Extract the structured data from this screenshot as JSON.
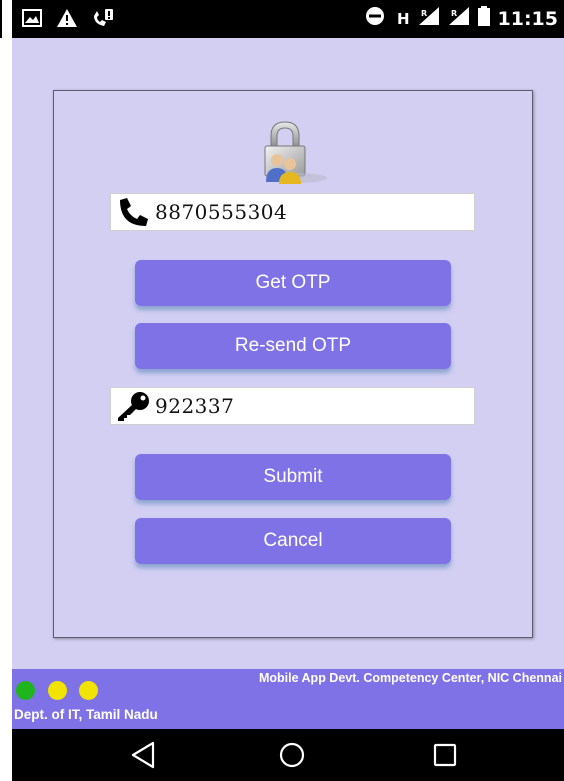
{
  "status_bar": {
    "left_icons": [
      "image-icon",
      "warning-icon",
      "phone-alert-icon"
    ],
    "right_icons": [
      "do-not-disturb-icon",
      "h-network-icon",
      "signal-r-icon",
      "signal-r-icon-2",
      "battery-icon"
    ],
    "h_label": "H",
    "time": "11:15"
  },
  "login": {
    "lock_icon": "lock-users-icon",
    "phone": {
      "icon": "phone-icon",
      "value": "8870555304"
    },
    "get_otp_label": "Get OTP",
    "resend_otp_label": "Re-send OTP",
    "otp": {
      "icon": "key-icon",
      "value": "922337"
    },
    "submit_label": "Submit",
    "cancel_label": "Cancel"
  },
  "footer": {
    "dots": [
      "#1fb51f",
      "#f2e300",
      "#f2e300"
    ],
    "credit": "Mobile App Devt. Competency Center, NIC Chennai",
    "dept": "Dept. of IT, Tamil Nadu"
  },
  "colors": {
    "background": "#d3cff3",
    "accent": "#7f72e7"
  },
  "nav_bar": {
    "icons": [
      "back-icon",
      "home-icon",
      "recents-icon"
    ]
  }
}
